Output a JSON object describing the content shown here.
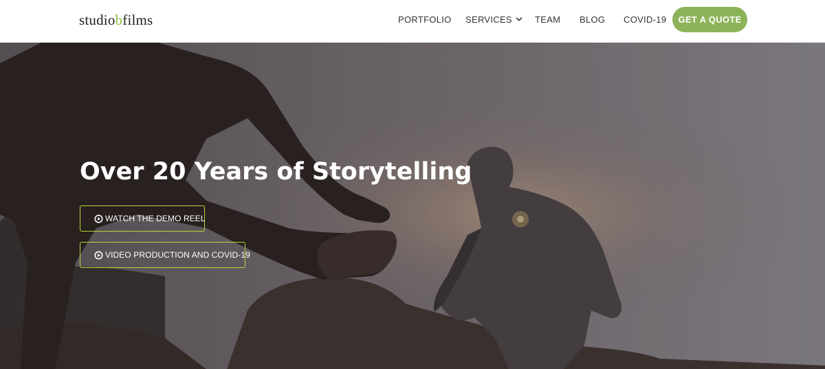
{
  "logo": {
    "part1": "studio",
    "part2": "b",
    "part3": "films"
  },
  "nav": {
    "portfolio": "PORTFOLIO",
    "services": "SERVICES",
    "team": "TEAM",
    "blog": "BLOG",
    "covid": "COVID-19",
    "quote": "GET A QUOTE"
  },
  "hero": {
    "title": "Over 20 Years of Storytelling",
    "buttons": [
      {
        "label": "WATCH THE DEMO REEL",
        "icon": "play-circle-icon"
      },
      {
        "label": "VIDEO PRODUCTION AND COVID-19",
        "icon": "play-circle-icon"
      }
    ]
  },
  "colors": {
    "brand_green": "#8db35a",
    "logo_accent": "#8dbb3e",
    "button_border": "#b8d83a",
    "nav_text": "#333333"
  }
}
